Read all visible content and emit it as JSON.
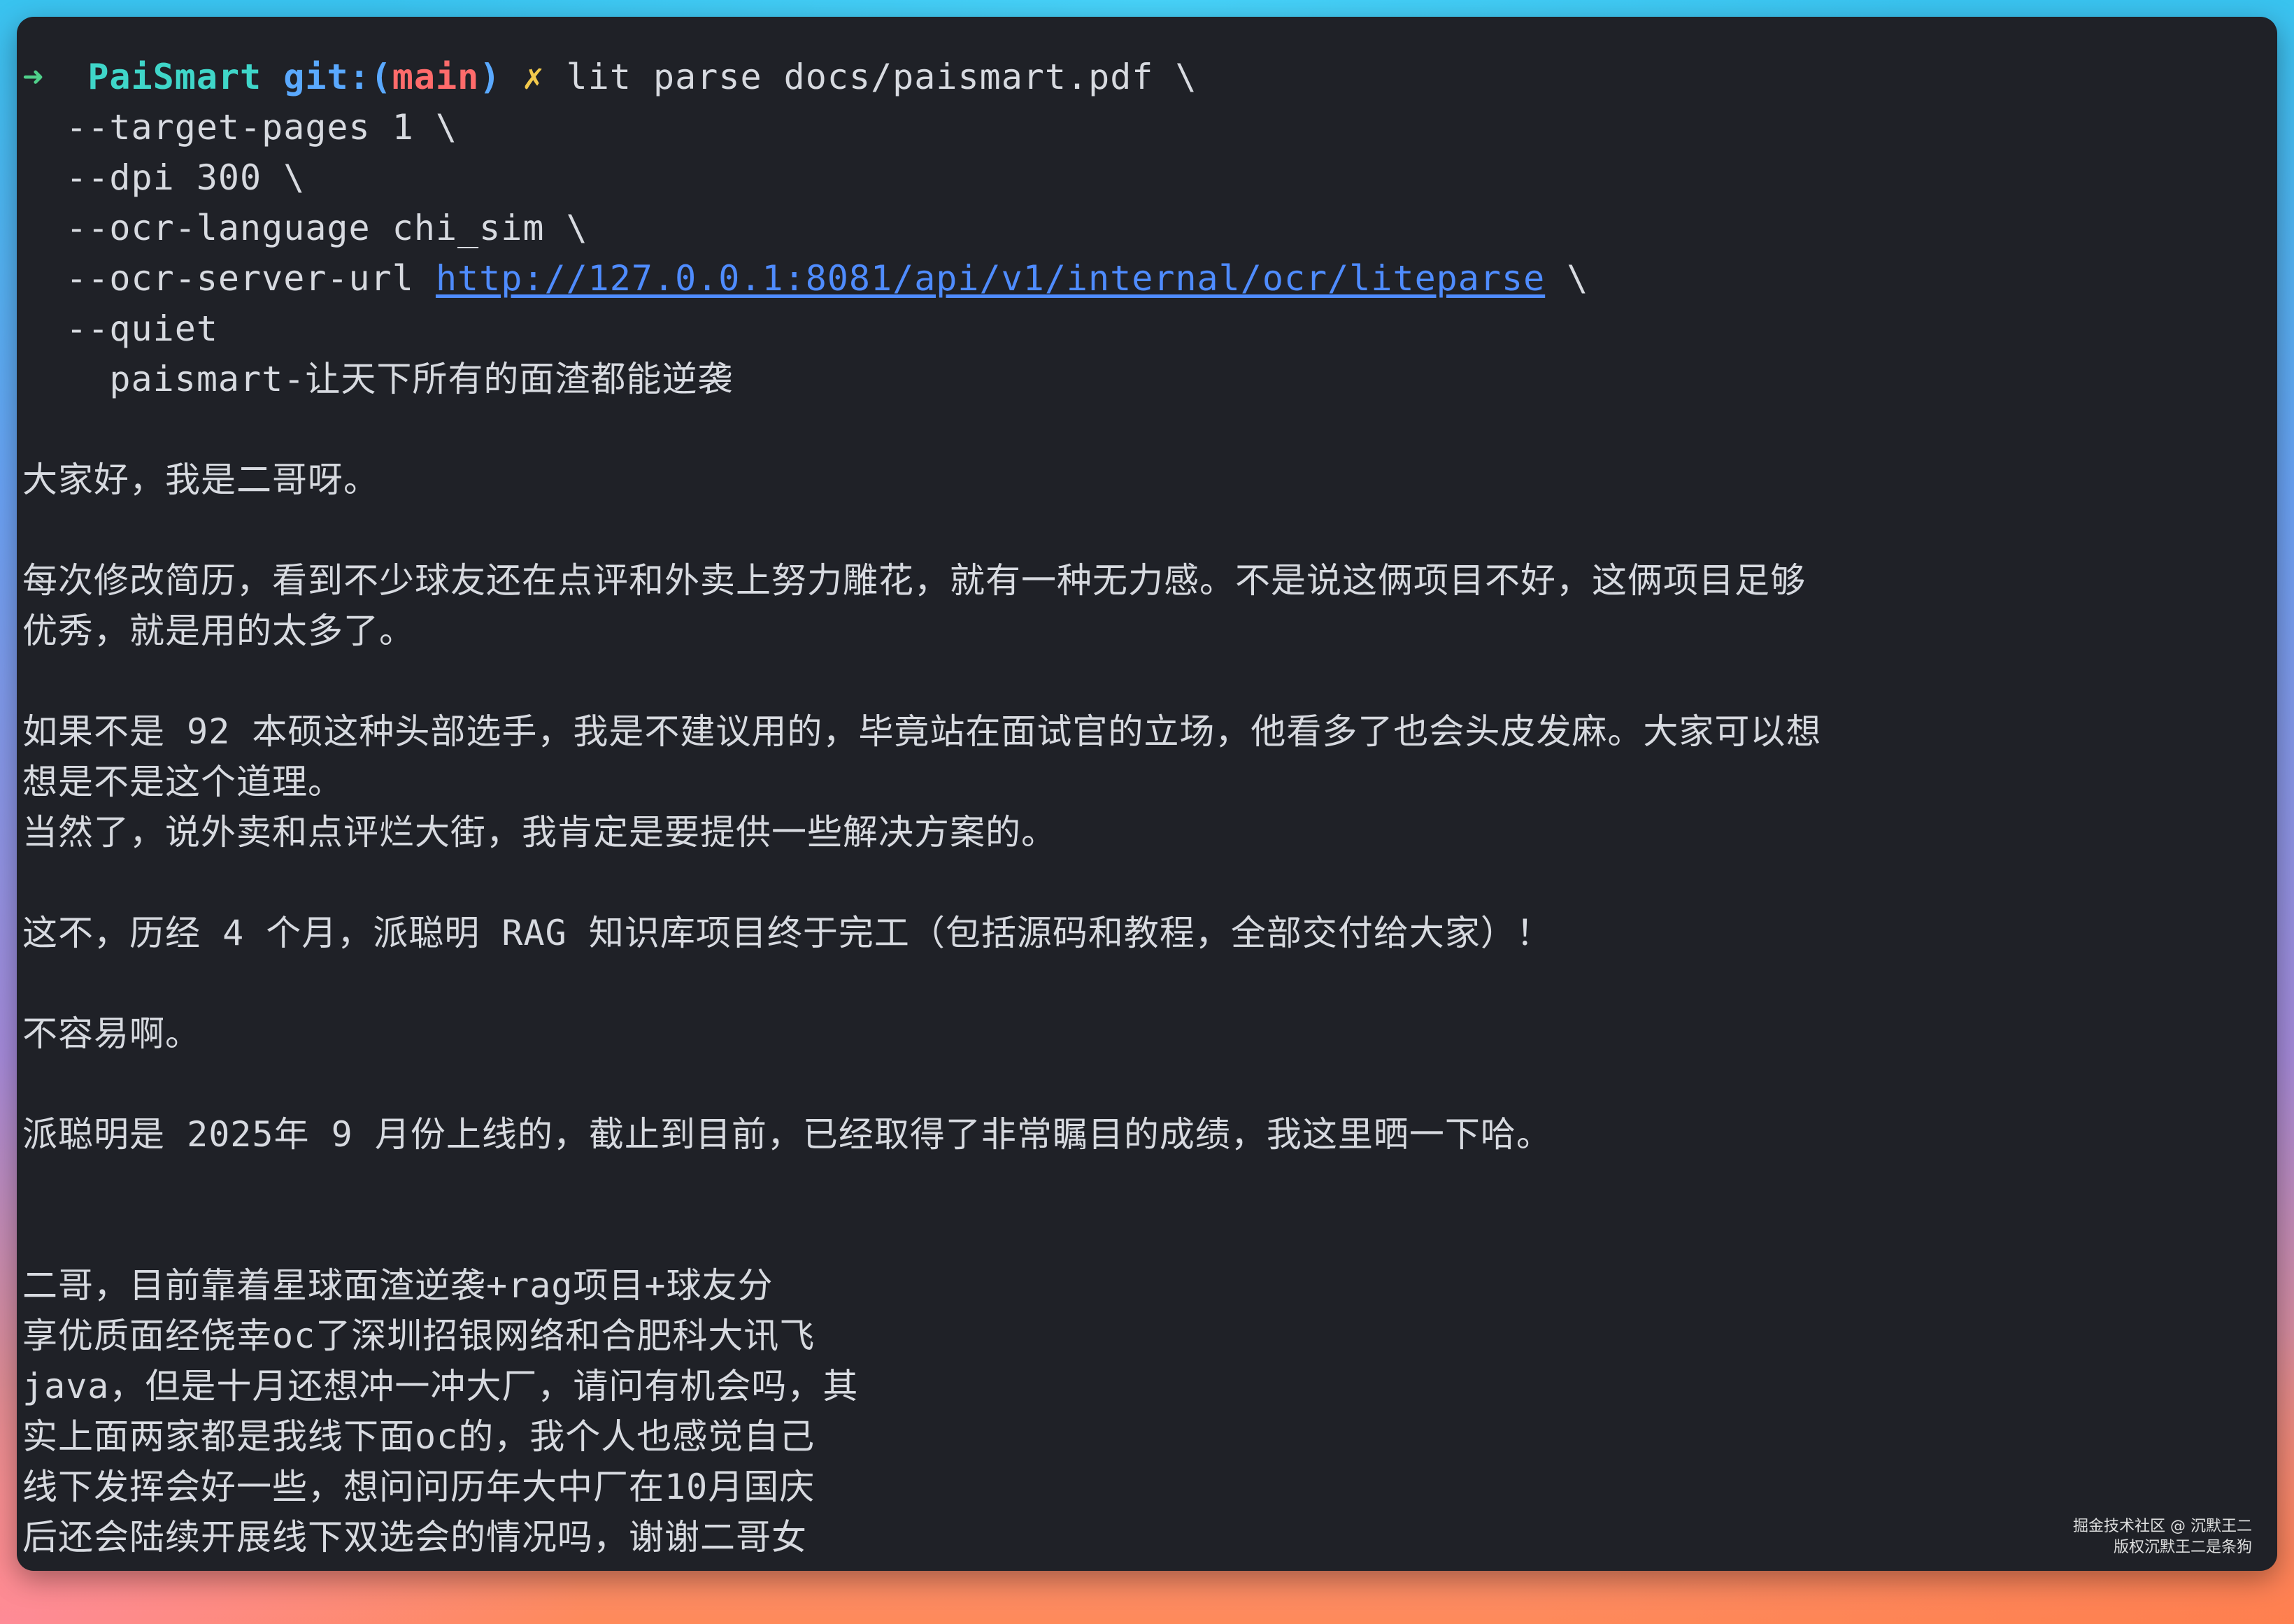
{
  "prompt": {
    "arrow": "➜",
    "directory": "PaiSmart",
    "git_label": "git:(",
    "branch": "main",
    "git_close": ")",
    "dirty_marker": "✗"
  },
  "command_lines": [
    "lit parse docs/paismart.pdf \\",
    "  --target-pages 1 \\",
    "  --dpi 300 \\",
    "  --ocr-language chi_sim \\",
    "  --ocr-server-url ",
    "  --quiet"
  ],
  "ocr_server_url": "http://127.0.0.1:8081/api/v1/internal/ocr/liteparse",
  "url_suffix": " \\",
  "output_lines": [
    "    paismart-让天下所有的面渣都能逆袭",
    "",
    "大家好，我是二哥呀。",
    "",
    "每次修改简历，看到不少球友还在点评和外卖上努力雕花，就有一种无力感。不是说这俩项目不好，这俩项目足够",
    "优秀，就是用的太多了。",
    "",
    "如果不是 92 本硕这种头部选手，我是不建议用的，毕竟站在面试官的立场，他看多了也会头皮发麻。大家可以想",
    "想是不是这个道理。",
    "当然了，说外卖和点评烂大街，我肯定是要提供一些解决方案的。",
    "",
    "这不，历经 4 个月，派聪明 RAG 知识库项目终于完工（包括源码和教程，全部交付给大家）！",
    "",
    "不容易啊。",
    "",
    "派聪明是 2025年 9 月份上线的，截止到目前，已经取得了非常瞩目的成绩，我这里晒一下哈。",
    "",
    "",
    "二哥，目前靠着星球面渣逆袭+rag项目+球友分",
    "享优质面经侥幸oc了深圳招银网络和合肥科大讯飞",
    "java，但是十月还想冲一冲大厂，请问有机会吗，其",
    "实上面两家都是我线下面oc的，我个人也感觉自己",
    "线下发挥会好一些，想问问历年大中厂在10月国庆",
    "后还会陆续开展线下双选会的情况吗，谢谢二哥女"
  ],
  "watermark": {
    "line1": "掘金技术社区 @ 沉默王二",
    "line2": "版权沉默王二是条狗"
  }
}
